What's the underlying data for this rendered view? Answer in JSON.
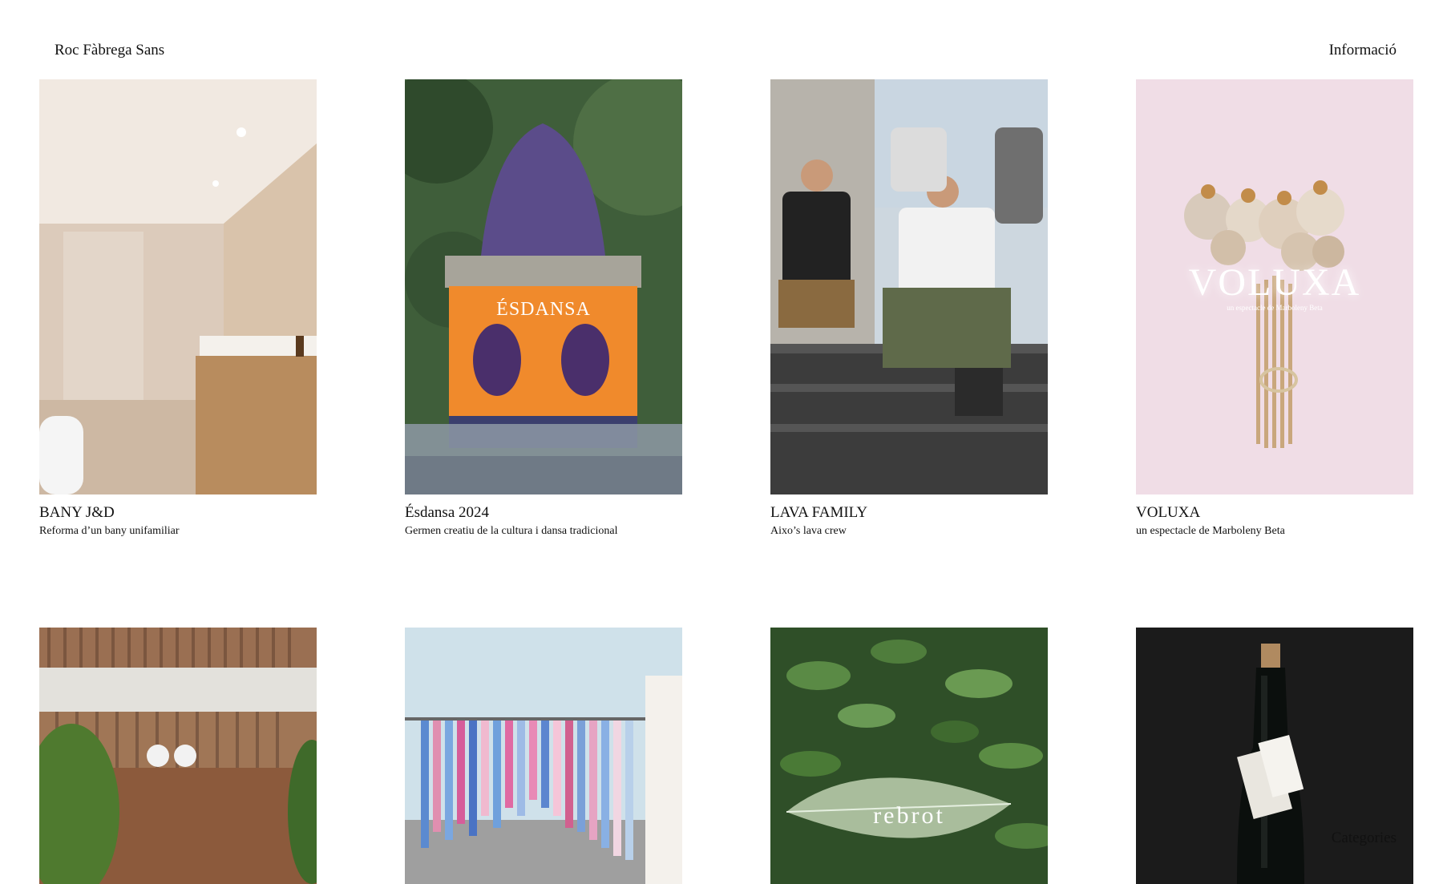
{
  "header": {
    "site_title": "Roc Fàbrega Sans",
    "info_link": "Informació",
    "categories_link": "Categories"
  },
  "projects": [
    {
      "title": "BANY J&D",
      "subtitle": "Reforma d’un bany unifamiliar"
    },
    {
      "title": "Ésdansa 2024",
      "subtitle": "Germen creatiu de la cultura i dansa tradicional"
    },
    {
      "title": "LAVA FAMILY",
      "subtitle": "Aixo’s lava crew"
    },
    {
      "title": "VOLUXA",
      "subtitle": "un espectacle de Marboleny Beta"
    }
  ],
  "image_text": {
    "esdansa_poster": "ÉSDANSA",
    "voluxa_word": "VOLUXA",
    "voluxa_small": "un espectacle de Marboleny Beta",
    "rebrot": "rebrot"
  }
}
